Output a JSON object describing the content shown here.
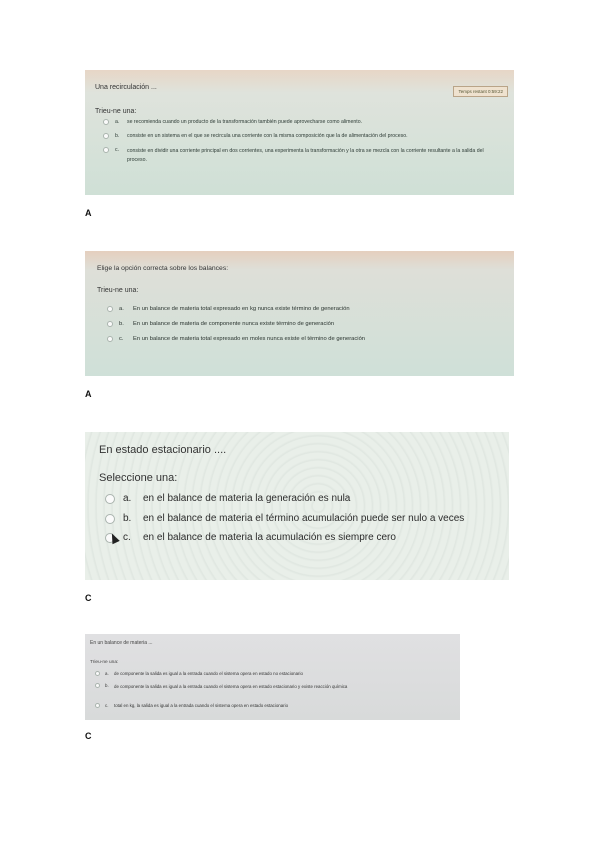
{
  "shots": [
    {
      "question": "Una recirculación ...",
      "timer": "Temps restant 0:59:22",
      "prompt": "Trieu-ne una:",
      "options": [
        {
          "letter": "a.",
          "text": "se recomienda cuando un producto de la transformación también puede aprovecharse como alimento."
        },
        {
          "letter": "b.",
          "text": "consiste en un sistema en el que se recircula una corriente con la misma composición que la de alimentación del proceso."
        },
        {
          "letter": "c.",
          "text": "consiste en dividir una corriente principal en dos corrientes, una experimenta la transformación y la otra se mezcla con la corriente resultante a la salida del proceso."
        }
      ],
      "answer": "A"
    },
    {
      "question": "Elige la opción correcta sobre los balances:",
      "prompt": "Trieu-ne una:",
      "options": [
        {
          "letter": "a.",
          "text": "En un balance de materia total expresado en kg nunca existe término de generación"
        },
        {
          "letter": "b.",
          "text": "En un balance de materia de componente nunca existe término de generación"
        },
        {
          "letter": "c.",
          "text": "En un balance de materia total expresado en moles nunca existe el término de generación"
        }
      ],
      "answer": "A"
    },
    {
      "question": "En estado estacionario ....",
      "prompt": "Seleccione una:",
      "options": [
        {
          "letter": "a.",
          "text": "en el balance de materia la generación es nula"
        },
        {
          "letter": "b.",
          "text": "en el balance de materia el término acumulación puede ser nulo a veces"
        },
        {
          "letter": "c.",
          "text": "en el balance de materia la acumulación es siempre cero"
        }
      ],
      "answer": "C"
    },
    {
      "question": "En un balance de materia ...",
      "prompt": "Trieu-ne una:",
      "options": [
        {
          "letter": "a.",
          "text": "de componente la salida es igual a la entrada cuando el sistema opera en estado no estacionario"
        },
        {
          "letter": "b.",
          "text": "de componente la salida es igual a la entrada cuando el sistema opera en estado estacionario y existe reacción química"
        },
        {
          "letter": "c.",
          "text": "total en kg, la salida es igual a la entrada cuando el sistema opera en estado estacionario"
        }
      ],
      "answer": "C"
    }
  ]
}
